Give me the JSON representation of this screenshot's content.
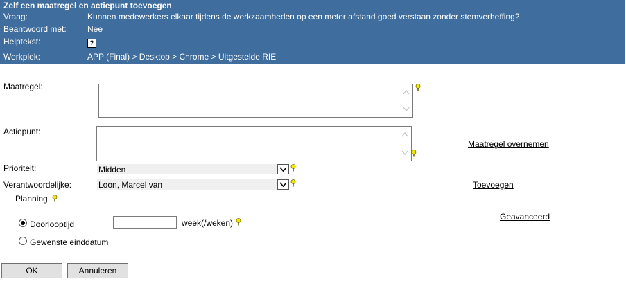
{
  "header": {
    "title": "Zelf een maatregel en actiepunt toevoegen",
    "question_label": "Vraag:",
    "question_value": "Kunnen medewerkers elkaar tijdens de werkzaamheden op een meter afstand goed verstaan zonder stemverheffing?",
    "answer_label": "Beantwoord met:",
    "answer_value": "Nee",
    "help_label": "Helptekst:",
    "help_icon": "?",
    "workplace_label": "Werkplek:",
    "workplace_value": "APP (Final) > Desktop > Chrome > Uitgestelde RIE"
  },
  "form": {
    "measure_label": "Maatregel:",
    "measure_value": "",
    "actionpoint_label": "Actiepunt:",
    "actionpoint_value": "",
    "copy_measure_link": "Maatregel overnemen",
    "priority_label": "Prioriteit:",
    "priority_value": "Midden",
    "responsible_label": "Verantwoordelijke:",
    "responsible_value": "Loon, Marcel van",
    "add_link": "Toevoegen"
  },
  "planning": {
    "legend": "Planning",
    "duration_label": "Doorlooptijd",
    "duration_value": "",
    "duration_unit": "week(/weken)",
    "enddate_label": "Gewenste einddatum",
    "advanced_link": "Geavanceerd",
    "selected": "Doorlooptijd"
  },
  "buttons": {
    "ok": "OK",
    "cancel": "Annuleren"
  },
  "colors": {
    "header_bg": "#3f6e9e",
    "key_icon": "#f5e600"
  }
}
